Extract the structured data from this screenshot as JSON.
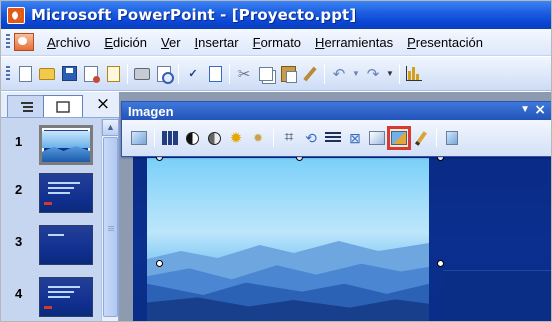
{
  "window": {
    "title": "Microsoft PowerPoint - [Proyecto.ppt]",
    "icon": "powerpoint-app-icon"
  },
  "menu": {
    "items": [
      {
        "label": "Archivo",
        "key": "A",
        "rest": "rchivo"
      },
      {
        "label": "Edición",
        "key": "E",
        "rest": "dición"
      },
      {
        "label": "Ver",
        "key": "V",
        "rest": "er"
      },
      {
        "label": "Insertar",
        "key": "I",
        "rest": "nsertar"
      },
      {
        "label": "Formato",
        "key": "F",
        "rest": "ormato"
      },
      {
        "label": "Herramientas",
        "key": "H",
        "rest": "erramientas"
      },
      {
        "label": "Presentación",
        "key": "P",
        "rest": "resentación"
      }
    ]
  },
  "standard_toolbar": {
    "icons": [
      "new-icon",
      "open-icon",
      "save-icon",
      "permission-icon",
      "email-icon",
      "print-icon",
      "print-preview-icon",
      "spelling-icon",
      "research-icon",
      "cut-icon",
      "copy-icon",
      "paste-icon",
      "format-painter-icon",
      "undo-icon",
      "redo-icon",
      "insert-chart-icon"
    ]
  },
  "left_panel": {
    "tabs": [
      "outline-tab",
      "slides-tab"
    ],
    "close_symbol": "×",
    "slides": [
      {
        "number": "1",
        "selected": true
      },
      {
        "number": "2",
        "selected": false
      },
      {
        "number": "3",
        "selected": false
      },
      {
        "number": "4",
        "selected": false
      }
    ]
  },
  "image_toolbar": {
    "title": "Imagen",
    "dropdown_symbol": "▼",
    "close_symbol": "×",
    "highlighted_button": "recolor-picture-icon",
    "buttons": [
      "insert-picture-icon",
      "color-icon",
      "more-contrast-icon",
      "less-contrast-icon",
      "more-brightness-icon",
      "less-brightness-icon",
      "crop-icon",
      "rotate-left-icon",
      "line-style-icon",
      "compress-pictures-icon",
      "recolor-picture-icon",
      "format-picture-icon",
      "set-transparent-color-icon",
      "reset-picture-icon"
    ]
  },
  "colors": {
    "titlebar": "#0a46d6",
    "highlight": "#d53a33",
    "slide_background": "#0a2f8f"
  }
}
